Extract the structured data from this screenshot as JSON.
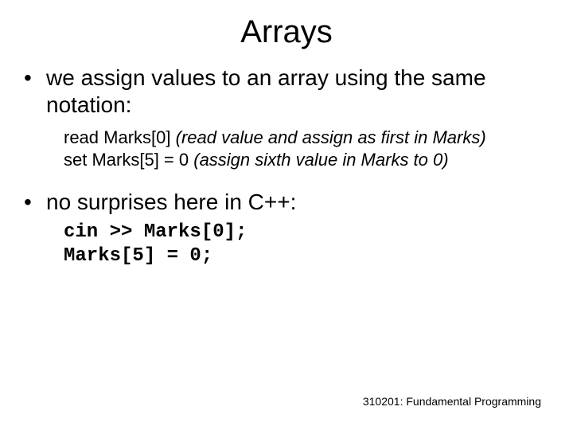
{
  "title": "Arrays",
  "bullet1": "we assign values to an array using the same notation:",
  "pseudo1_cmd": "read Marks[0]",
  "pseudo1_note": "  (read value and assign as first in Marks)",
  "pseudo2_cmd": "set Marks[5] = 0",
  "pseudo2_note": "  (assign sixth value in Marks to 0)",
  "bullet2": "no surprises here in C++:",
  "code1": "cin >> Marks[0];",
  "code2": "Marks[5] = 0;",
  "footer": "310201: Fundamental Programming"
}
